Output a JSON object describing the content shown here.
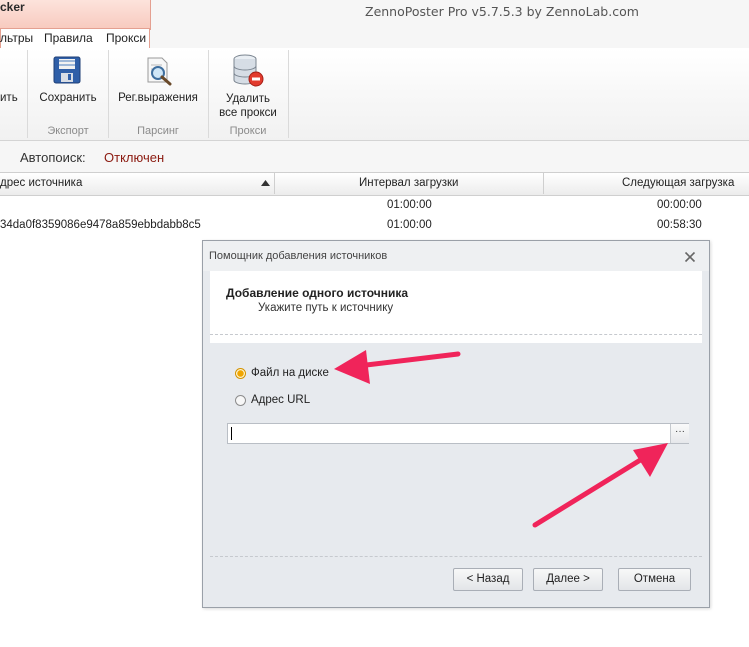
{
  "app": {
    "tab_label": "cker",
    "window_title": "ZennoPoster Pro v5.7.5.3 by ZennoLab.com"
  },
  "menu": [
    "льтры",
    "Правила",
    "Прокси"
  ],
  "ribbon": {
    "partial_button": "ить",
    "buttons": [
      {
        "label": "Сохранить",
        "icon": "floppy-disk-icon"
      },
      {
        "label": "Рег.выражения",
        "icon": "search-document-icon"
      },
      {
        "label": "Удалить\nвсе прокси",
        "icon": "database-remove-icon"
      }
    ],
    "groups": [
      "Экспорт",
      "Парсинг",
      "Прокси"
    ]
  },
  "status": {
    "label": "Автопоиск:",
    "value": "Отключен",
    "value_color": "#8b1a10"
  },
  "table": {
    "columns": [
      "дрес источника",
      "Интервал загрузки",
      "Следующая загрузка"
    ],
    "rows": [
      [
        "",
        "01:00:00",
        "00:00:00"
      ],
      [
        "34da0f8359086e9478a859ebbdabb8c5",
        "01:00:00",
        "00:58:30"
      ]
    ]
  },
  "dialog": {
    "title": "Помощник добавления источников",
    "heading": "Добавление одного источника",
    "subheading": "Укажите путь к источнику",
    "options": [
      {
        "label": "Файл на диске",
        "selected": true
      },
      {
        "label": "Адрес URL",
        "selected": false
      }
    ],
    "path_value": "",
    "browse_label": "···",
    "buttons": {
      "back": "< Назад",
      "next": "Далее >",
      "cancel": "Отмена"
    }
  },
  "annotations": {
    "arrow_color": "#f0245a"
  }
}
